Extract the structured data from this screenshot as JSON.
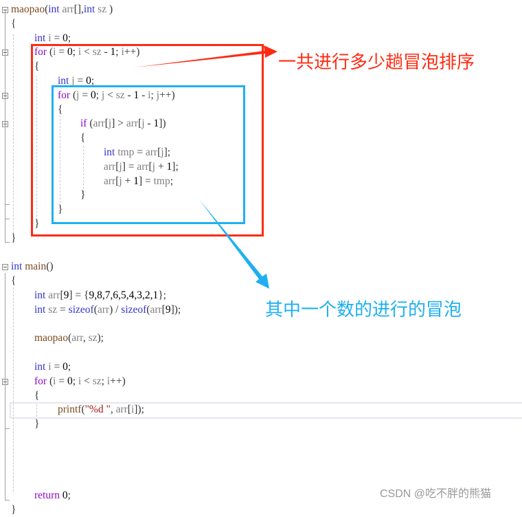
{
  "editor": {
    "language": "C",
    "lines": [
      {
        "row": 0,
        "indent": 0,
        "tokens": [
          [
            "fn",
            "maopao"
          ],
          [
            "pun",
            "("
          ],
          [
            "kw",
            "int"
          ],
          [
            "var",
            " arr"
          ],
          [
            "pun",
            "[],"
          ],
          [
            "kw",
            "int"
          ],
          [
            "var",
            " sz "
          ],
          [
            "pun",
            ")"
          ]
        ]
      },
      {
        "row": 1,
        "indent": 0,
        "tokens": [
          [
            "pun",
            "{"
          ]
        ]
      },
      {
        "row": 2,
        "indent": 1,
        "tokens": [
          [
            "kw",
            "int"
          ],
          [
            "var",
            " i"
          ],
          [
            "pun",
            " = "
          ],
          [
            "num",
            "0"
          ],
          [
            "pun",
            ";"
          ]
        ]
      },
      {
        "row": 3,
        "indent": 1,
        "tokens": [
          [
            "kw2",
            "for"
          ],
          [
            "pun",
            " ("
          ],
          [
            "var",
            "i"
          ],
          [
            "pun",
            " = "
          ],
          [
            "num",
            "0"
          ],
          [
            "pun",
            "; "
          ],
          [
            "var",
            "i"
          ],
          [
            "pun",
            " < "
          ],
          [
            "sz",
            "sz"
          ],
          [
            "pun",
            " - "
          ],
          [
            "num",
            "1"
          ],
          [
            "pun",
            "; "
          ],
          [
            "var",
            "i"
          ],
          [
            "pun",
            "++)"
          ]
        ]
      },
      {
        "row": 4,
        "indent": 1,
        "tokens": [
          [
            "pun",
            "{"
          ]
        ]
      },
      {
        "row": 5,
        "indent": 2,
        "tokens": [
          [
            "kw",
            "int"
          ],
          [
            "var",
            " j"
          ],
          [
            "pun",
            " = "
          ],
          [
            "num",
            "0"
          ],
          [
            "pun",
            ";"
          ]
        ]
      },
      {
        "row": 6,
        "indent": 2,
        "tokens": [
          [
            "kw2",
            "for"
          ],
          [
            "pun",
            " ("
          ],
          [
            "var",
            "j"
          ],
          [
            "pun",
            " = "
          ],
          [
            "num",
            "0"
          ],
          [
            "pun",
            "; "
          ],
          [
            "var",
            "j"
          ],
          [
            "pun",
            " < "
          ],
          [
            "sz",
            "sz"
          ],
          [
            "pun",
            " - "
          ],
          [
            "num",
            "1"
          ],
          [
            "pun",
            " - "
          ],
          [
            "var",
            "i"
          ],
          [
            "pun",
            "; "
          ],
          [
            "var",
            "j"
          ],
          [
            "pun",
            "++)"
          ]
        ]
      },
      {
        "row": 7,
        "indent": 2,
        "tokens": [
          [
            "pun",
            "{"
          ]
        ]
      },
      {
        "row": 8,
        "indent": 3,
        "tokens": [
          [
            "kw2",
            "if"
          ],
          [
            "pun",
            " ("
          ],
          [
            "var",
            "arr"
          ],
          [
            "pun",
            "["
          ],
          [
            "var",
            "j"
          ],
          [
            "pun",
            "] > "
          ],
          [
            "var",
            "arr"
          ],
          [
            "pun",
            "["
          ],
          [
            "var",
            "j"
          ],
          [
            "pun",
            " - "
          ],
          [
            "num",
            "1"
          ],
          [
            "pun",
            "])"
          ]
        ]
      },
      {
        "row": 9,
        "indent": 3,
        "tokens": [
          [
            "pun",
            "{"
          ]
        ]
      },
      {
        "row": 10,
        "indent": 4,
        "tokens": [
          [
            "kw",
            "int"
          ],
          [
            "var",
            " tmp"
          ],
          [
            "pun",
            " = "
          ],
          [
            "var",
            "arr"
          ],
          [
            "pun",
            "["
          ],
          [
            "var",
            "j"
          ],
          [
            "pun",
            "];"
          ]
        ]
      },
      {
        "row": 11,
        "indent": 4,
        "tokens": [
          [
            "var",
            "arr"
          ],
          [
            "pun",
            "["
          ],
          [
            "var",
            "j"
          ],
          [
            "pun",
            "] = "
          ],
          [
            "var",
            "arr"
          ],
          [
            "pun",
            "["
          ],
          [
            "var",
            "j"
          ],
          [
            "pun",
            " + "
          ],
          [
            "num",
            "1"
          ],
          [
            "pun",
            "];"
          ]
        ]
      },
      {
        "row": 12,
        "indent": 4,
        "tokens": [
          [
            "var",
            "arr"
          ],
          [
            "pun",
            "["
          ],
          [
            "var",
            "j"
          ],
          [
            "pun",
            " + "
          ],
          [
            "num",
            "1"
          ],
          [
            "pun",
            "] = "
          ],
          [
            "var",
            "tmp"
          ],
          [
            "pun",
            ";"
          ]
        ]
      },
      {
        "row": 13,
        "indent": 3,
        "tokens": [
          [
            "pun",
            "}"
          ]
        ]
      },
      {
        "row": 14,
        "indent": 2,
        "tokens": [
          [
            "pun",
            "}"
          ]
        ]
      },
      {
        "row": 15,
        "indent": 1,
        "tokens": [
          [
            "pun",
            "}"
          ]
        ]
      },
      {
        "row": 16,
        "indent": 0,
        "tokens": [
          [
            "pun",
            "}"
          ]
        ]
      },
      {
        "row": 18,
        "indent": 0,
        "tokens": [
          [
            "kw",
            "int"
          ],
          [
            "fn",
            " main"
          ],
          [
            "pun",
            "()"
          ]
        ]
      },
      {
        "row": 19,
        "indent": 0,
        "tokens": [
          [
            "pun",
            "{"
          ]
        ]
      },
      {
        "row": 20,
        "indent": 1,
        "tokens": [
          [
            "kw",
            "int"
          ],
          [
            "var",
            " arr"
          ],
          [
            "pun",
            "["
          ],
          [
            "num",
            "9"
          ],
          [
            "pun",
            "] = {"
          ],
          [
            "num",
            "9,8,7,6,5,4,3,2,1"
          ],
          [
            "pun",
            "};"
          ]
        ]
      },
      {
        "row": 21,
        "indent": 1,
        "tokens": [
          [
            "kw",
            "int"
          ],
          [
            "var",
            " sz"
          ],
          [
            "pun",
            " = "
          ],
          [
            "kw",
            "sizeof"
          ],
          [
            "pun",
            "("
          ],
          [
            "var",
            "arr"
          ],
          [
            "pun",
            ") / "
          ],
          [
            "kw",
            "sizeof"
          ],
          [
            "pun",
            "("
          ],
          [
            "var",
            "arr"
          ],
          [
            "pun",
            "["
          ],
          [
            "num",
            "9"
          ],
          [
            "pun",
            "]);"
          ]
        ]
      },
      {
        "row": 23,
        "indent": 1,
        "tokens": [
          [
            "fn",
            "maopao"
          ],
          [
            "pun",
            "("
          ],
          [
            "var",
            "arr"
          ],
          [
            "pun",
            ", "
          ],
          [
            "var",
            "sz"
          ],
          [
            "pun",
            ");"
          ]
        ]
      },
      {
        "row": 25,
        "indent": 1,
        "tokens": [
          [
            "kw",
            "int"
          ],
          [
            "var",
            " i"
          ],
          [
            "pun",
            " = "
          ],
          [
            "num",
            "0"
          ],
          [
            "pun",
            ";"
          ]
        ]
      },
      {
        "row": 26,
        "indent": 1,
        "tokens": [
          [
            "kw2",
            "for"
          ],
          [
            "pun",
            " ("
          ],
          [
            "var",
            "i"
          ],
          [
            "pun",
            " = "
          ],
          [
            "num",
            "0"
          ],
          [
            "pun",
            "; "
          ],
          [
            "var",
            "i"
          ],
          [
            "pun",
            " < "
          ],
          [
            "var",
            "sz"
          ],
          [
            "pun",
            "; "
          ],
          [
            "var",
            "i"
          ],
          [
            "pun",
            "++)"
          ]
        ]
      },
      {
        "row": 27,
        "indent": 1,
        "tokens": [
          [
            "pun",
            "{"
          ]
        ]
      },
      {
        "row": 28,
        "indent": 2,
        "tokens": [
          [
            "fn",
            "printf"
          ],
          [
            "pun",
            "("
          ],
          [
            "str",
            "\"%d \""
          ],
          [
            "pun",
            ", "
          ],
          [
            "var",
            "arr"
          ],
          [
            "pun",
            "["
          ],
          [
            "var",
            "i"
          ],
          [
            "pun",
            "]);"
          ]
        ]
      },
      {
        "row": 29,
        "indent": 1,
        "tokens": [
          [
            "pun",
            "}"
          ]
        ]
      },
      {
        "row": 34,
        "indent": 1,
        "tokens": [
          [
            "kw2",
            "return"
          ],
          [
            "num",
            " 0"
          ],
          [
            "pun",
            ";"
          ]
        ]
      },
      {
        "row": 35,
        "indent": 0,
        "tokens": [
          [
            "pun",
            "}"
          ]
        ]
      }
    ],
    "fold_markers": [
      0,
      3,
      6,
      8,
      18,
      26
    ],
    "highlighted_row": 28
  },
  "annotations": {
    "outer_loop_label": "一共进行多少趟冒泡排序",
    "inner_loop_label": "其中一个数的进行的冒泡",
    "outer_color": "#ff2a12",
    "inner_color": "#1eb0f0"
  },
  "watermark": "CSDN @吃不胖的熊猫"
}
